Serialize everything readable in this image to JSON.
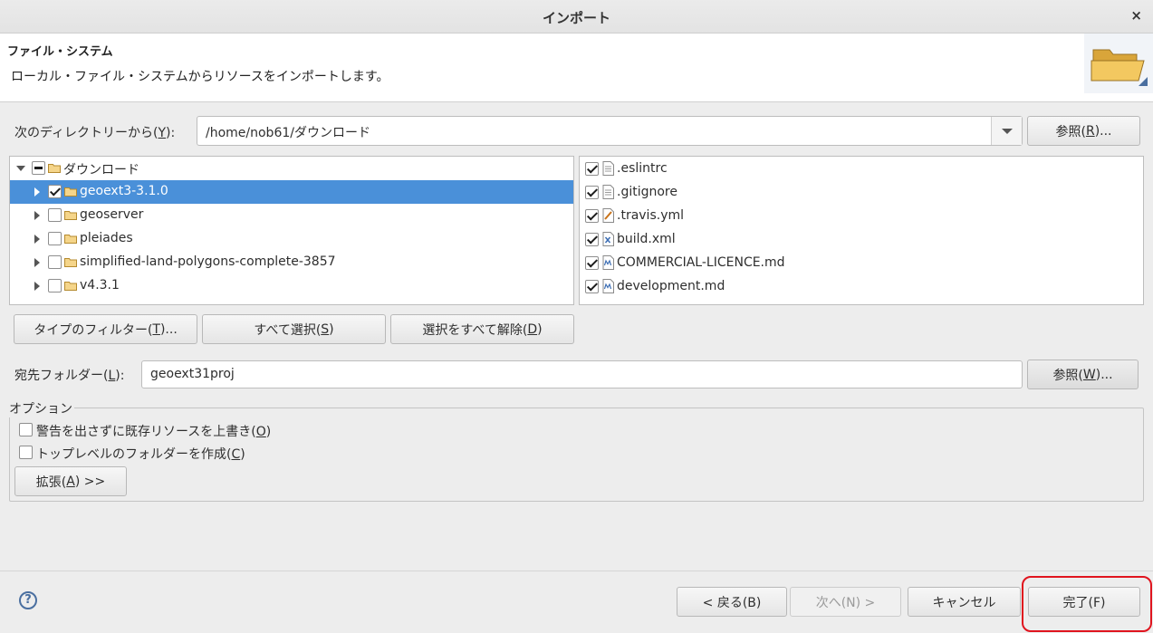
{
  "window": {
    "title": "インポート",
    "close_glyph": "×"
  },
  "banner": {
    "heading": "ファイル・システム",
    "description": "ローカル・ファイル・システムからリソースをインポートします。",
    "icon": "folder-open-icon"
  },
  "from_dir": {
    "label_pre": "次のディレクトリーから(",
    "label_key": "Y",
    "label_post": "):",
    "value": "/home/nob61/ダウンロード",
    "browse_pre": "参照(",
    "browse_key": "R",
    "browse_post": ")..."
  },
  "tree": [
    {
      "label": "ダウンロード",
      "check": "mixed",
      "expander": "open",
      "selected": false
    },
    {
      "label": "geoext3-3.1.0",
      "check": "on",
      "expander": "closed",
      "selected": true
    },
    {
      "label": "geoserver",
      "check": "off",
      "expander": "closed",
      "selected": false
    },
    {
      "label": "pleiades",
      "check": "off",
      "expander": "closed",
      "selected": false
    },
    {
      "label": "simplified-land-polygons-complete-3857",
      "check": "off",
      "expander": "closed",
      "selected": false
    },
    {
      "label": "v4.3.1",
      "check": "off",
      "expander": "closed",
      "selected": false
    }
  ],
  "files": [
    {
      "label": ".eslintrc",
      "check": "on",
      "icon": "text-file-icon"
    },
    {
      "label": ".gitignore",
      "check": "on",
      "icon": "text-file-icon"
    },
    {
      "label": ".travis.yml",
      "check": "on",
      "icon": "yaml-file-icon"
    },
    {
      "label": "build.xml",
      "check": "on",
      "icon": "xml-file-icon"
    },
    {
      "label": "COMMERCIAL-LICENCE.md",
      "check": "on",
      "icon": "markdown-file-icon"
    },
    {
      "label": "development.md",
      "check": "on",
      "icon": "markdown-file-icon"
    }
  ],
  "selection_buttons": {
    "filter_pre": "タイプのフィルター(",
    "filter_key": "T",
    "filter_post": ")...",
    "select_all_pre": "すべて選択(",
    "select_all_key": "S",
    "select_all_post": ")",
    "deselect_all_pre": "選択をすべて解除(",
    "deselect_all_key": "D",
    "deselect_all_post": ")"
  },
  "dest": {
    "label_pre": "宛先フォルダー(",
    "label_key": "L",
    "label_post": "):",
    "value": "geoext31proj",
    "browse_pre": "参照(",
    "browse_key": "W",
    "browse_post": ")..."
  },
  "options": {
    "legend": "オプション",
    "overwrite_pre": "警告を出さずに既存リソースを上書き(",
    "overwrite_key": "O",
    "overwrite_post": ")",
    "overwrite_checked": false,
    "toplevel_pre": "トップレベルのフォルダーを作成(",
    "toplevel_key": "C",
    "toplevel_post": ")",
    "toplevel_checked": false,
    "advanced_pre": "拡張(",
    "advanced_key": "A",
    "advanced_post": ") >>"
  },
  "footer": {
    "help_glyph": "?",
    "back": "< 戻る(B)",
    "next": "次へ(N) >",
    "cancel": "キャンセル",
    "finish": "完了(F)"
  },
  "colors": {
    "selection": "#4a90d9",
    "highlight_ring": "#e0141e",
    "folder": "#e8b34a"
  }
}
